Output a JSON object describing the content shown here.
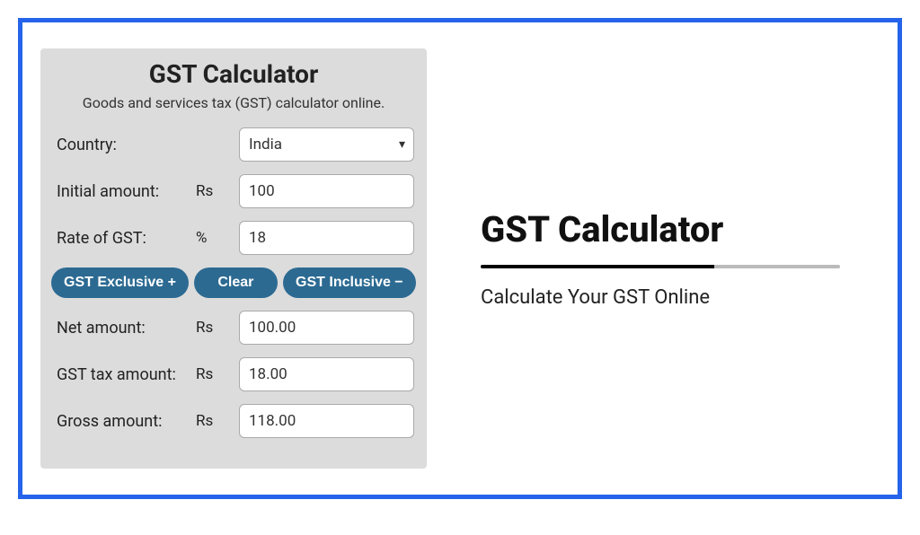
{
  "calculator": {
    "title": "GST Calculator",
    "subtitle": "Goods and services tax (GST) calculator online.",
    "fields": {
      "country": {
        "label": "Country:",
        "value": "India"
      },
      "initial_amount": {
        "label": "Initial amount:",
        "unit": "Rs",
        "value": "100"
      },
      "rate": {
        "label": "Rate of GST:",
        "unit": "%",
        "value": "18"
      },
      "net_amount": {
        "label": "Net amount:",
        "unit": "Rs",
        "value": "100.00"
      },
      "gst_amount": {
        "label": "GST tax amount:",
        "unit": "Rs",
        "value": "18.00"
      },
      "gross_amount": {
        "label": "Gross amount:",
        "unit": "Rs",
        "value": "118.00"
      }
    },
    "buttons": {
      "exclusive": "GST Exclusive +",
      "clear": "Clear",
      "inclusive": "GST Inclusive −"
    }
  },
  "promo": {
    "title": "GST Calculator",
    "subtitle": "Calculate Your GST Online"
  }
}
